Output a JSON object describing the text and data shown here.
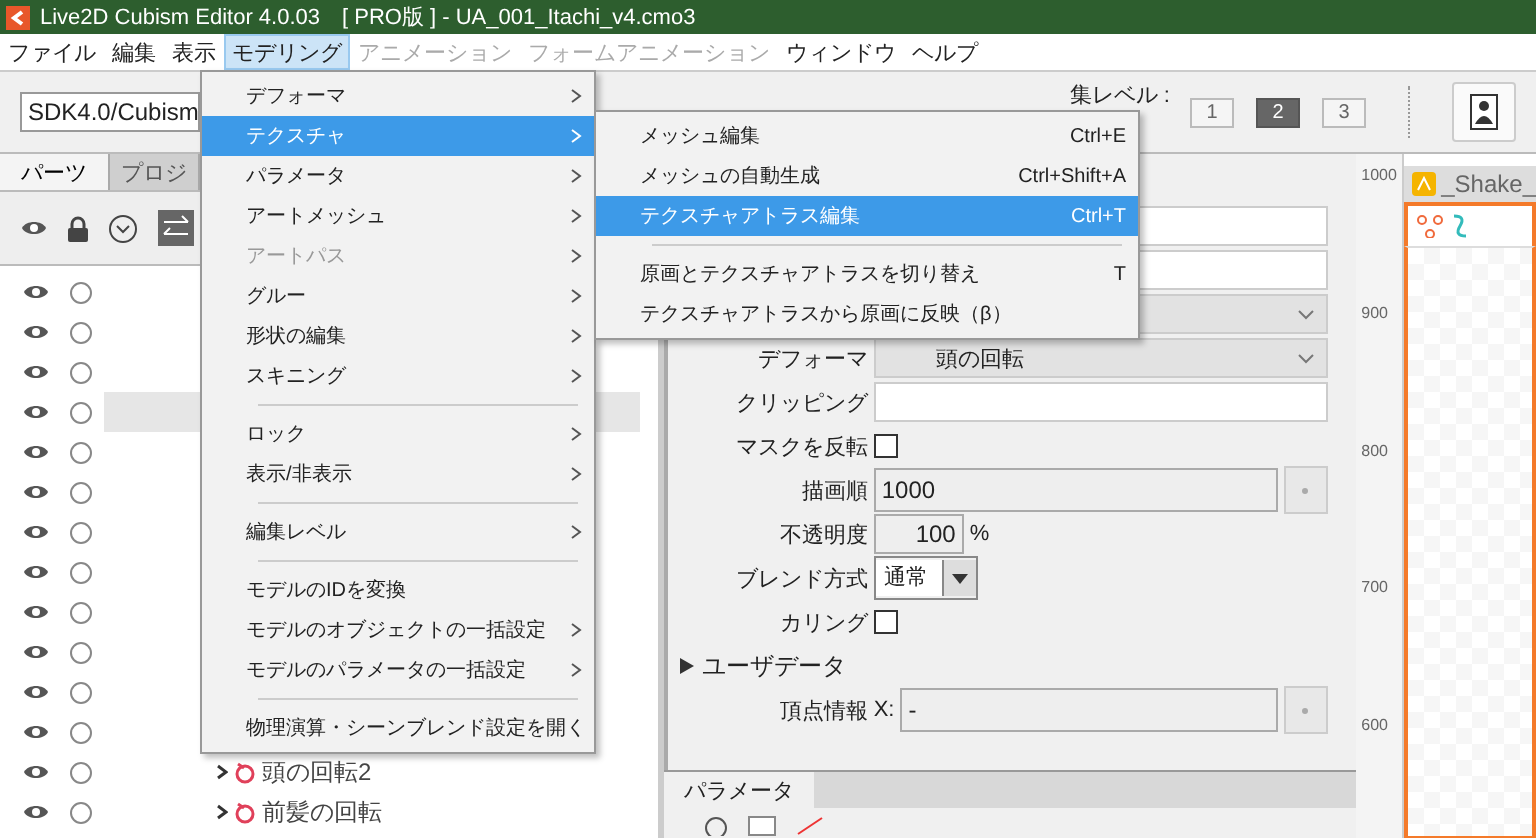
{
  "window": {
    "title": "Live2D Cubism Editor 4.0.03　[ PRO版 ] - UA_001_Itachi_v4.cmo3"
  },
  "menubar": [
    {
      "label": "ファイル",
      "selected": false,
      "disabled": false
    },
    {
      "label": "編集",
      "selected": false,
      "disabled": false
    },
    {
      "label": "表示",
      "selected": false,
      "disabled": false
    },
    {
      "label": "モデリング",
      "selected": true,
      "disabled": false
    },
    {
      "label": "アニメーション",
      "selected": false,
      "disabled": true
    },
    {
      "label": "フォームアニメーション",
      "selected": false,
      "disabled": true
    },
    {
      "label": "ウィンドウ",
      "selected": false,
      "disabled": false
    },
    {
      "label": "ヘルプ",
      "selected": false,
      "disabled": false
    }
  ],
  "toolbar": {
    "preset_dropdown": "SDK4.0/Cubism",
    "edit_level_label": "集レベル :",
    "edit_levels": [
      {
        "label": "1",
        "selected": false
      },
      {
        "label": "2",
        "selected": true
      },
      {
        "label": "3",
        "selected": false
      }
    ]
  },
  "parts_panel": {
    "tabs": [
      {
        "label": "パーツ",
        "selected": true
      },
      {
        "label": "プロジ",
        "selected": false
      }
    ],
    "rows": [
      {
        "visible": true,
        "selected": false
      },
      {
        "visible": true,
        "selected": false
      },
      {
        "visible": true,
        "selected": false
      },
      {
        "visible": true,
        "selected": true
      },
      {
        "visible": true,
        "selected": false
      },
      {
        "visible": true,
        "selected": false
      },
      {
        "visible": true,
        "selected": false
      },
      {
        "visible": true,
        "selected": false
      },
      {
        "visible": true,
        "selected": false
      },
      {
        "visible": true,
        "selected": false
      },
      {
        "visible": true,
        "selected": false
      },
      {
        "visible": true,
        "selected": false
      },
      {
        "visible": true,
        "selected": false,
        "label": "頭の回転2"
      },
      {
        "visible": true,
        "selected": false,
        "label": "前髪の回転"
      }
    ]
  },
  "modeling_menu": [
    {
      "kind": "item",
      "label": "デフォーマ",
      "submenu": true,
      "selected": false,
      "disabled": false
    },
    {
      "kind": "item",
      "label": "テクスチャ",
      "submenu": true,
      "selected": true,
      "disabled": false
    },
    {
      "kind": "item",
      "label": "パラメータ",
      "submenu": true,
      "selected": false,
      "disabled": false
    },
    {
      "kind": "item",
      "label": "アートメッシュ",
      "submenu": true,
      "selected": false,
      "disabled": false
    },
    {
      "kind": "item",
      "label": "アートパス",
      "submenu": true,
      "selected": false,
      "disabled": true
    },
    {
      "kind": "item",
      "label": "グルー",
      "submenu": true,
      "selected": false,
      "disabled": false
    },
    {
      "kind": "item",
      "label": "形状の編集",
      "submenu": true,
      "selected": false,
      "disabled": false
    },
    {
      "kind": "item",
      "label": "スキニング",
      "submenu": true,
      "selected": false,
      "disabled": false
    },
    {
      "kind": "separator"
    },
    {
      "kind": "item",
      "label": "ロック",
      "submenu": true,
      "selected": false,
      "disabled": false
    },
    {
      "kind": "item",
      "label": "表示/非表示",
      "submenu": true,
      "selected": false,
      "disabled": false
    },
    {
      "kind": "separator"
    },
    {
      "kind": "item",
      "label": "編集レベル",
      "submenu": true,
      "selected": false,
      "disabled": false
    },
    {
      "kind": "separator"
    },
    {
      "kind": "item",
      "label": "モデルのIDを変換",
      "selected": false,
      "disabled": false
    },
    {
      "kind": "item",
      "label": "モデルのオブジェクトの一括設定",
      "submenu": true,
      "selected": false,
      "disabled": false
    },
    {
      "kind": "item",
      "label": "モデルのパラメータの一括設定",
      "submenu": true,
      "selected": false,
      "disabled": false
    },
    {
      "kind": "separator"
    },
    {
      "kind": "item",
      "label": "物理演算・シーンブレンド設定を開く",
      "selected": false,
      "disabled": false
    }
  ],
  "texture_submenu": [
    {
      "kind": "item",
      "label": "メッシュ編集",
      "shortcut": "Ctrl+E",
      "selected": false
    },
    {
      "kind": "item",
      "label": "メッシュの自動生成",
      "shortcut": "Ctrl+Shift+A",
      "selected": false
    },
    {
      "kind": "item",
      "label": "テクスチャアトラス編集",
      "shortcut": "Ctrl+T",
      "selected": true
    },
    {
      "kind": "separator"
    },
    {
      "kind": "item",
      "label": "原画とテクスチャアトラスを切り替え",
      "shortcut": "T",
      "selected": false
    },
    {
      "kind": "item",
      "label": "テクスチャアトラスから原画に反映（β）",
      "selected": false
    }
  ],
  "inspector": [
    {
      "kind": "text"
    },
    {
      "kind": "text"
    },
    {
      "kind": "select"
    },
    {
      "kind": "select",
      "label": "デフォーマ",
      "value": "頭の回転"
    },
    {
      "kind": "text",
      "label": "クリッピング"
    },
    {
      "kind": "checkbox",
      "label": "マスクを反転",
      "checked": false
    },
    {
      "kind": "number",
      "label": "描画順",
      "value": "1000"
    },
    {
      "kind": "percent",
      "label": "不透明度",
      "value": "100",
      "unit": "%"
    },
    {
      "kind": "blend",
      "label": "ブレンド方式",
      "value": "通常"
    },
    {
      "kind": "checkbox",
      "label": "カリング",
      "checked": false
    },
    {
      "kind": "section",
      "label": "ユーザデータ",
      "expanded": false
    },
    {
      "kind": "vertex",
      "label": "頂点情報",
      "axis": "X:",
      "value": "-"
    }
  ],
  "parameter_panel": {
    "tab": "パラメータ"
  },
  "canvas": {
    "tab": "_Shake_",
    "ruler": [
      "1000",
      "900",
      "800",
      "700",
      "600"
    ]
  }
}
